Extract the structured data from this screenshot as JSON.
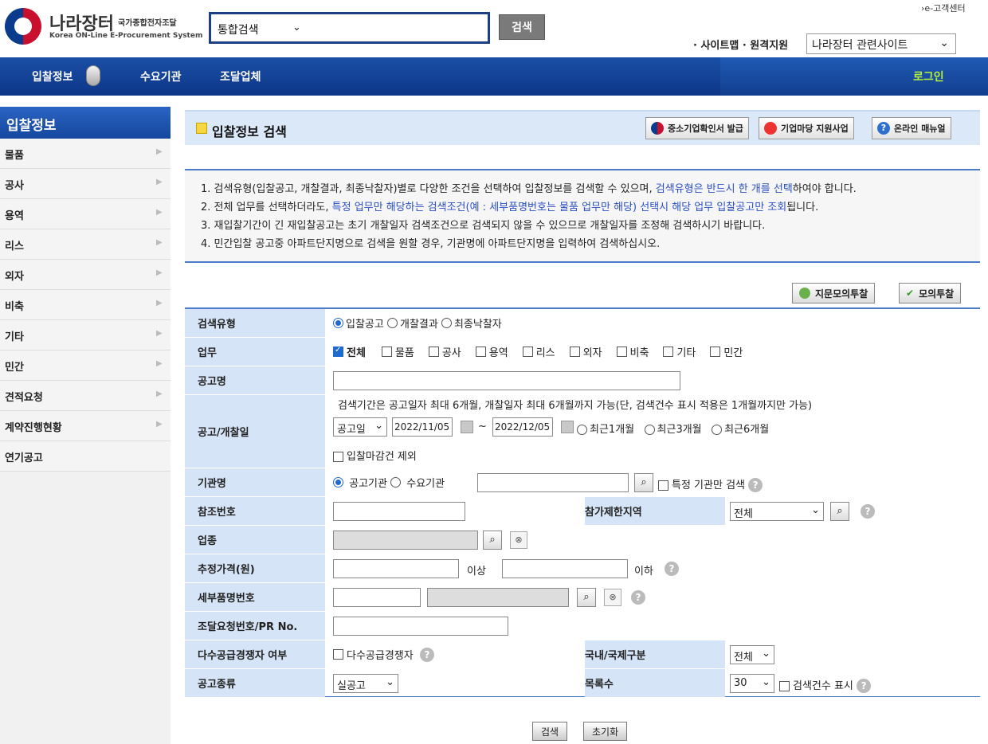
{
  "header": {
    "logo_title": "나라장터",
    "logo_sub": "국가종합전자조달",
    "logo_en": "Korea ON-Line E-Procurement System",
    "search_select": "통합검색",
    "search_button": "검색",
    "cs_link": "›e-고객센터",
    "sitemap": "· 사이트맵 · 원격지원",
    "related_select": "나라장터 관련사이트"
  },
  "nav": {
    "items": [
      "입찰정보",
      "수요기관",
      "조달업체"
    ],
    "login": "로그인"
  },
  "sidebar": {
    "title": "입찰정보",
    "items": [
      "물품",
      "공사",
      "용역",
      "리스",
      "외자",
      "비축",
      "기타",
      "민간",
      "견적요청",
      "계약진행현황",
      "연기공고"
    ]
  },
  "page": {
    "title": "입찰정보 검색",
    "btn_sme": "중소기업확인서 발급",
    "btn_madang": "기업마당 지원사업",
    "btn_manual": "온라인 매뉴얼"
  },
  "notice": {
    "l1a": "1. 검색유형(입찰공고, 개찰결과, 최종낙찰자)별로 다양한 조건을 선택하여 입찰정보를 검색할 수 있으며, ",
    "l1b": "검색유형은 반드시 한 개를 선택",
    "l1c": "하여야 합니다.",
    "l2a": "2. 전체 업무를 선택하더라도, ",
    "l2b": "특정 업무만 해당하는 검색조건(예 : 세부품명번호는 물품 업무만 해당) 선택시 해당 업무 입찰공고만 조회",
    "l2c": "됩니다.",
    "l3": "3. 재입찰기간이 긴 재입찰공고는 초기 개찰일자 검색조건으로 검색되지 않을 수 있으므로 개찰일자를 조정해 검색하시기 바랍니다.",
    "l4": "4. 민간입찰 공고중 아파트단지명으로 검색을 원할 경우, 기관명에 아파트단지명을 입력하여 검색하십시오."
  },
  "extra": {
    "fingerprint": "지문모의투찰",
    "mock": "모의투찰"
  },
  "form": {
    "search_type_label": "검색유형",
    "search_types": [
      "입찰공고",
      "개찰결과",
      "최종낙찰자"
    ],
    "business_label": "업무",
    "business_all": "전체",
    "business_items": [
      "물품",
      "공사",
      "용역",
      "리스",
      "외자",
      "비축",
      "기타",
      "민간"
    ],
    "notice_name_label": "공고명",
    "date_label": "공고/개찰일",
    "date_note": "검색기간은 공고일자 최대 6개월, 개찰일자 최대 6개월까지 가능(단, 검색건수 표시 적용은 1개월까지만 가능)",
    "date_type": "공고일",
    "date_from": "2022/11/05",
    "date_tilde": "~",
    "date_to": "2022/12/05",
    "recent": [
      "최근1개월",
      "최근3개월",
      "최근6개월"
    ],
    "exclude_closed": "입찰마감건 제외",
    "org_label": "기관명",
    "org_types": [
      "공고기관",
      "수요기관"
    ],
    "org_only": "특정 기관만 검색",
    "ref_label": "참조번호",
    "region_label": "참가제한지역",
    "region_value": "전체",
    "industry_label": "업종",
    "price_label": "추정가격(원)",
    "price_min_suffix": "이상",
    "price_max_suffix": "이하",
    "detail_label": "세부품명번호",
    "pr_label": "조달요청번호/PR No.",
    "multi_label": "다수공급경쟁자 여부",
    "multi_check": "다수공급경쟁자",
    "intl_label": "국내/국제구분",
    "intl_value": "전체",
    "kind_label": "공고종류",
    "kind_value": "실공고",
    "count_label": "목록수",
    "count_value": "30",
    "count_check": "검색건수 표시"
  },
  "buttons": {
    "search": "검색",
    "reset": "초기화"
  }
}
